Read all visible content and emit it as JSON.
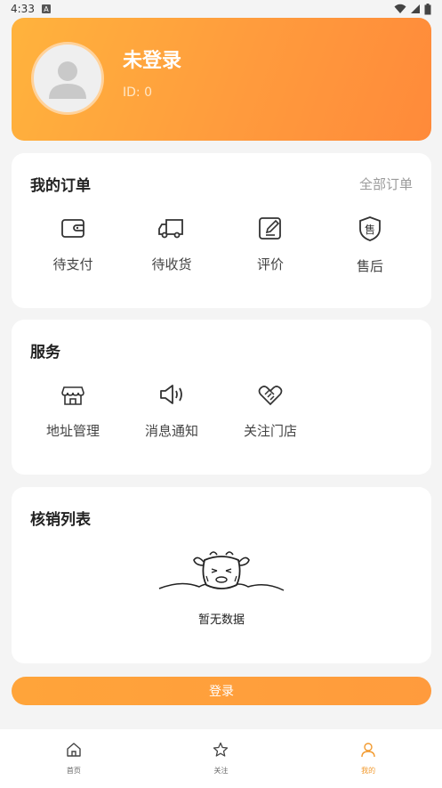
{
  "status": {
    "time": "4:33",
    "notif_letter": "A"
  },
  "profile": {
    "name": "未登录",
    "id_text": "ID: 0"
  },
  "orders": {
    "title": "我的订单",
    "all_label": "全部订单",
    "items": [
      {
        "label": "待支付",
        "icon": "wallet-icon"
      },
      {
        "label": "待收货",
        "icon": "truck-icon"
      },
      {
        "label": "评价",
        "icon": "edit-icon"
      },
      {
        "label": "售后",
        "icon": "shield-icon",
        "glyph": "售"
      }
    ]
  },
  "services": {
    "title": "服务",
    "items": [
      {
        "label": "地址管理",
        "icon": "store-icon"
      },
      {
        "label": "消息通知",
        "icon": "speaker-icon"
      },
      {
        "label": "关注门店",
        "icon": "handshake-icon"
      }
    ]
  },
  "verify": {
    "title": "核销列表",
    "empty_text": "暂无数据"
  },
  "login_button": "登录",
  "tabbar": {
    "items": [
      {
        "label": "首页",
        "icon": "home-icon"
      },
      {
        "label": "关注",
        "icon": "star-icon"
      },
      {
        "label": "我的",
        "icon": "user-icon",
        "active": true
      }
    ],
    "active_color": "#f29a2e"
  },
  "colors": {
    "accent": "#ff9b3d",
    "background": "#f4f4f4"
  }
}
